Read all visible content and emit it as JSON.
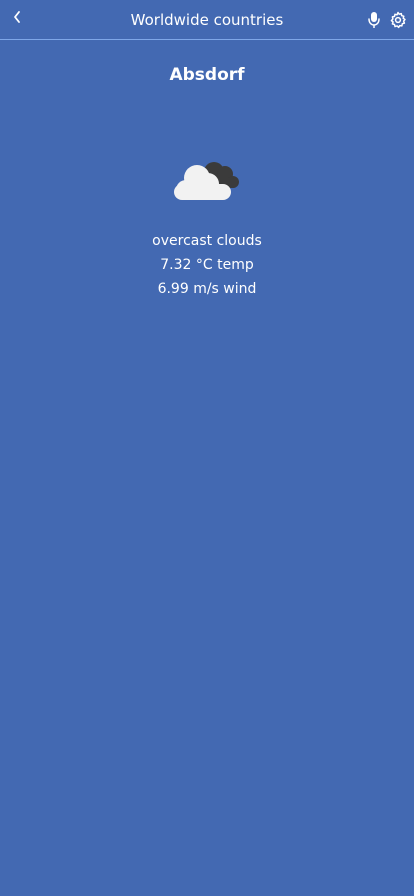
{
  "header": {
    "title": "Worldwide countries",
    "back_icon": "chevron-left-icon",
    "mic_icon": "microphone-icon",
    "settings_icon": "gear-icon"
  },
  "weather": {
    "city": "Absdorf",
    "icon": "overcast-clouds-icon",
    "description": "overcast clouds",
    "temperature": "7.32 °C temp",
    "wind": "6.99 m/s wind"
  },
  "colors": {
    "background": "#4369B2",
    "header_divider": "#7FA7E8",
    "text": "#FFFFFF",
    "cloud_light": "#F2F2F2",
    "cloud_dark": "#3B3B3B"
  }
}
